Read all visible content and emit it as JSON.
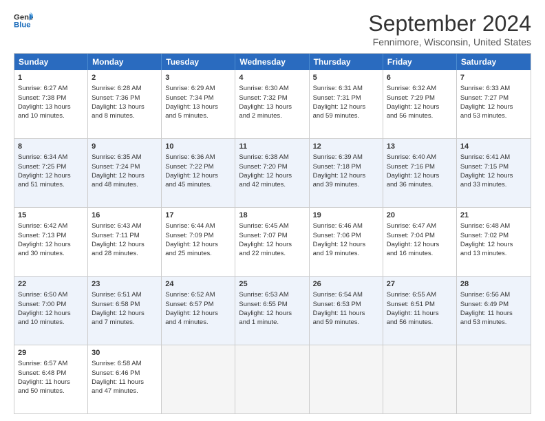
{
  "header": {
    "logo_general": "General",
    "logo_blue": "Blue",
    "month": "September 2024",
    "location": "Fennimore, Wisconsin, United States"
  },
  "days_of_week": [
    "Sunday",
    "Monday",
    "Tuesday",
    "Wednesday",
    "Thursday",
    "Friday",
    "Saturday"
  ],
  "rows": [
    {
      "alt": false,
      "cells": [
        {
          "day": "1",
          "lines": [
            "Sunrise: 6:27 AM",
            "Sunset: 7:38 PM",
            "Daylight: 13 hours",
            "and 10 minutes."
          ]
        },
        {
          "day": "2",
          "lines": [
            "Sunrise: 6:28 AM",
            "Sunset: 7:36 PM",
            "Daylight: 13 hours",
            "and 8 minutes."
          ]
        },
        {
          "day": "3",
          "lines": [
            "Sunrise: 6:29 AM",
            "Sunset: 7:34 PM",
            "Daylight: 13 hours",
            "and 5 minutes."
          ]
        },
        {
          "day": "4",
          "lines": [
            "Sunrise: 6:30 AM",
            "Sunset: 7:32 PM",
            "Daylight: 13 hours",
            "and 2 minutes."
          ]
        },
        {
          "day": "5",
          "lines": [
            "Sunrise: 6:31 AM",
            "Sunset: 7:31 PM",
            "Daylight: 12 hours",
            "and 59 minutes."
          ]
        },
        {
          "day": "6",
          "lines": [
            "Sunrise: 6:32 AM",
            "Sunset: 7:29 PM",
            "Daylight: 12 hours",
            "and 56 minutes."
          ]
        },
        {
          "day": "7",
          "lines": [
            "Sunrise: 6:33 AM",
            "Sunset: 7:27 PM",
            "Daylight: 12 hours",
            "and 53 minutes."
          ]
        }
      ]
    },
    {
      "alt": true,
      "cells": [
        {
          "day": "8",
          "lines": [
            "Sunrise: 6:34 AM",
            "Sunset: 7:25 PM",
            "Daylight: 12 hours",
            "and 51 minutes."
          ]
        },
        {
          "day": "9",
          "lines": [
            "Sunrise: 6:35 AM",
            "Sunset: 7:24 PM",
            "Daylight: 12 hours",
            "and 48 minutes."
          ]
        },
        {
          "day": "10",
          "lines": [
            "Sunrise: 6:36 AM",
            "Sunset: 7:22 PM",
            "Daylight: 12 hours",
            "and 45 minutes."
          ]
        },
        {
          "day": "11",
          "lines": [
            "Sunrise: 6:38 AM",
            "Sunset: 7:20 PM",
            "Daylight: 12 hours",
            "and 42 minutes."
          ]
        },
        {
          "day": "12",
          "lines": [
            "Sunrise: 6:39 AM",
            "Sunset: 7:18 PM",
            "Daylight: 12 hours",
            "and 39 minutes."
          ]
        },
        {
          "day": "13",
          "lines": [
            "Sunrise: 6:40 AM",
            "Sunset: 7:16 PM",
            "Daylight: 12 hours",
            "and 36 minutes."
          ]
        },
        {
          "day": "14",
          "lines": [
            "Sunrise: 6:41 AM",
            "Sunset: 7:15 PM",
            "Daylight: 12 hours",
            "and 33 minutes."
          ]
        }
      ]
    },
    {
      "alt": false,
      "cells": [
        {
          "day": "15",
          "lines": [
            "Sunrise: 6:42 AM",
            "Sunset: 7:13 PM",
            "Daylight: 12 hours",
            "and 30 minutes."
          ]
        },
        {
          "day": "16",
          "lines": [
            "Sunrise: 6:43 AM",
            "Sunset: 7:11 PM",
            "Daylight: 12 hours",
            "and 28 minutes."
          ]
        },
        {
          "day": "17",
          "lines": [
            "Sunrise: 6:44 AM",
            "Sunset: 7:09 PM",
            "Daylight: 12 hours",
            "and 25 minutes."
          ]
        },
        {
          "day": "18",
          "lines": [
            "Sunrise: 6:45 AM",
            "Sunset: 7:07 PM",
            "Daylight: 12 hours",
            "and 22 minutes."
          ]
        },
        {
          "day": "19",
          "lines": [
            "Sunrise: 6:46 AM",
            "Sunset: 7:06 PM",
            "Daylight: 12 hours",
            "and 19 minutes."
          ]
        },
        {
          "day": "20",
          "lines": [
            "Sunrise: 6:47 AM",
            "Sunset: 7:04 PM",
            "Daylight: 12 hours",
            "and 16 minutes."
          ]
        },
        {
          "day": "21",
          "lines": [
            "Sunrise: 6:48 AM",
            "Sunset: 7:02 PM",
            "Daylight: 12 hours",
            "and 13 minutes."
          ]
        }
      ]
    },
    {
      "alt": true,
      "cells": [
        {
          "day": "22",
          "lines": [
            "Sunrise: 6:50 AM",
            "Sunset: 7:00 PM",
            "Daylight: 12 hours",
            "and 10 minutes."
          ]
        },
        {
          "day": "23",
          "lines": [
            "Sunrise: 6:51 AM",
            "Sunset: 6:58 PM",
            "Daylight: 12 hours",
            "and 7 minutes."
          ]
        },
        {
          "day": "24",
          "lines": [
            "Sunrise: 6:52 AM",
            "Sunset: 6:57 PM",
            "Daylight: 12 hours",
            "and 4 minutes."
          ]
        },
        {
          "day": "25",
          "lines": [
            "Sunrise: 6:53 AM",
            "Sunset: 6:55 PM",
            "Daylight: 12 hours",
            "and 1 minute."
          ]
        },
        {
          "day": "26",
          "lines": [
            "Sunrise: 6:54 AM",
            "Sunset: 6:53 PM",
            "Daylight: 11 hours",
            "and 59 minutes."
          ]
        },
        {
          "day": "27",
          "lines": [
            "Sunrise: 6:55 AM",
            "Sunset: 6:51 PM",
            "Daylight: 11 hours",
            "and 56 minutes."
          ]
        },
        {
          "day": "28",
          "lines": [
            "Sunrise: 6:56 AM",
            "Sunset: 6:49 PM",
            "Daylight: 11 hours",
            "and 53 minutes."
          ]
        }
      ]
    },
    {
      "alt": false,
      "cells": [
        {
          "day": "29",
          "lines": [
            "Sunrise: 6:57 AM",
            "Sunset: 6:48 PM",
            "Daylight: 11 hours",
            "and 50 minutes."
          ]
        },
        {
          "day": "30",
          "lines": [
            "Sunrise: 6:58 AM",
            "Sunset: 6:46 PM",
            "Daylight: 11 hours",
            "and 47 minutes."
          ]
        },
        {
          "day": "",
          "lines": []
        },
        {
          "day": "",
          "lines": []
        },
        {
          "day": "",
          "lines": []
        },
        {
          "day": "",
          "lines": []
        },
        {
          "day": "",
          "lines": []
        }
      ]
    }
  ]
}
